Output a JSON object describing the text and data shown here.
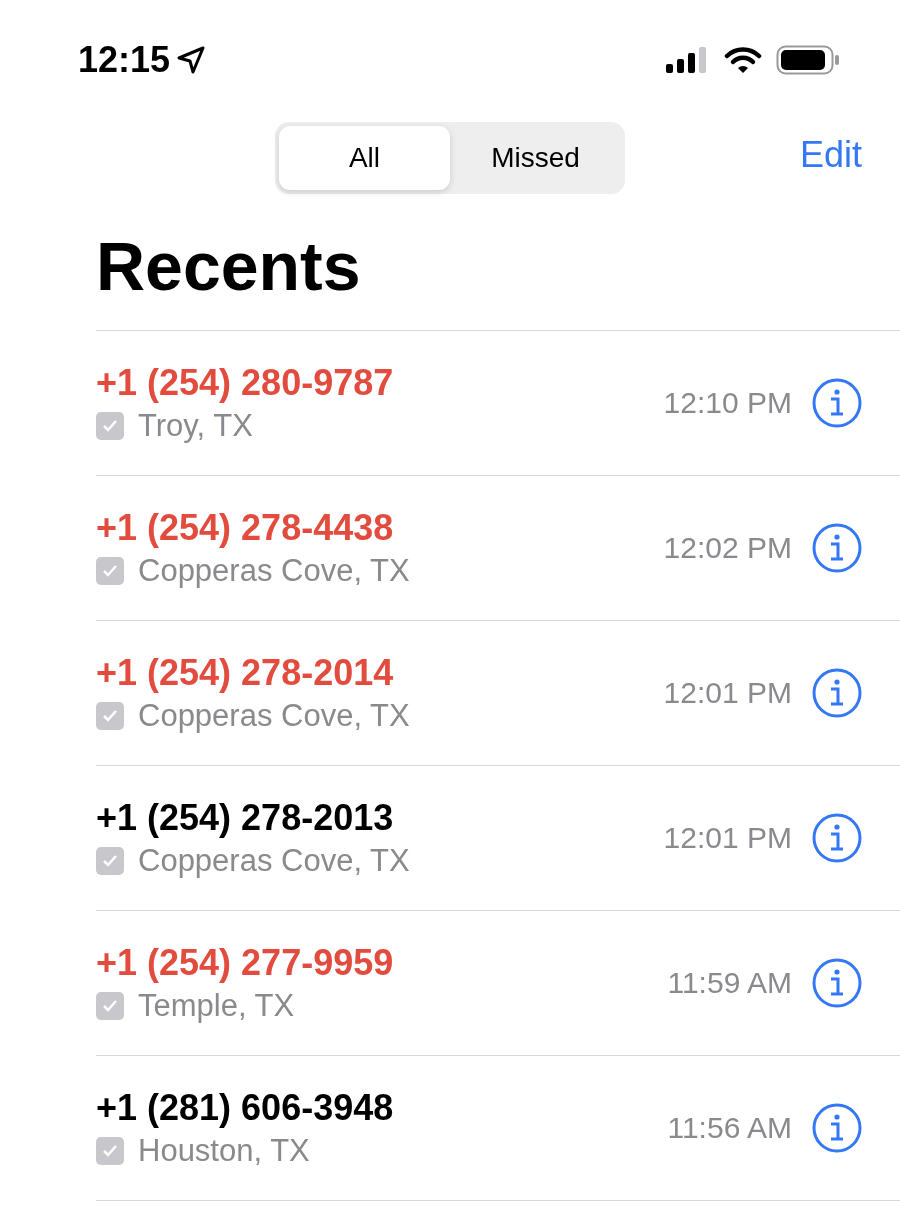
{
  "status_bar": {
    "time": "12:15"
  },
  "segments": [
    {
      "label": "All",
      "selected": true
    },
    {
      "label": "Missed",
      "selected": false
    }
  ],
  "edit_button": "Edit",
  "title": "Recents",
  "calls": [
    {
      "number": "+1 (254) 280-9787",
      "location": "Troy, TX",
      "time": "12:10 PM",
      "missed": true
    },
    {
      "number": "+1 (254) 278-4438",
      "location": "Copperas Cove, TX",
      "time": "12:02 PM",
      "missed": true
    },
    {
      "number": "+1 (254) 278-2014",
      "location": "Copperas Cove, TX",
      "time": "12:01 PM",
      "missed": true
    },
    {
      "number": "+1 (254) 278-2013",
      "location": "Copperas Cove, TX",
      "time": "12:01 PM",
      "missed": false
    },
    {
      "number": "+1 (254) 277-9959",
      "location": "Temple, TX",
      "time": "11:59 AM",
      "missed": true
    },
    {
      "number": "+1 (281) 606-3948",
      "location": "Houston, TX",
      "time": "11:56 AM",
      "missed": false
    }
  ]
}
